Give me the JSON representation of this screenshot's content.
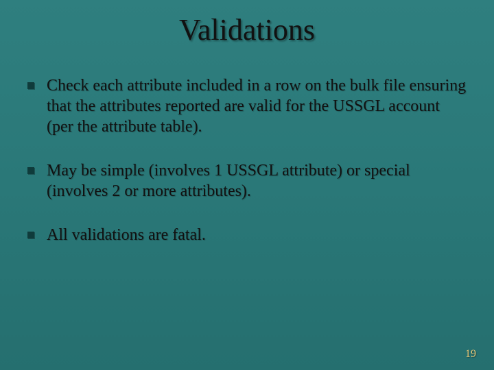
{
  "slide": {
    "title": "Validations",
    "bullets": [
      "Check each attribute included in a row on the bulk file ensuring that the attributes reported are valid for the USSGL account (per the attribute table).",
      "May be simple (involves 1 USSGL attribute) or special (involves 2 or more attributes).",
      "All validations are fatal."
    ],
    "page_number": "19"
  }
}
